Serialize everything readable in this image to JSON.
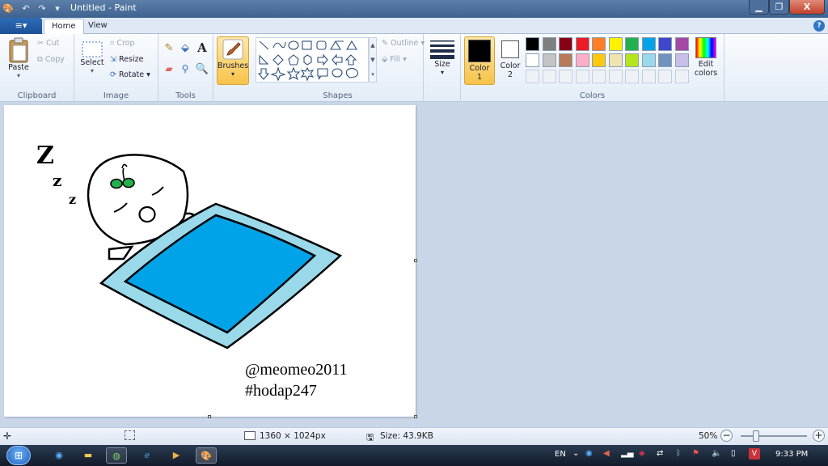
{
  "window": {
    "title": "Untitled - Paint",
    "min": "▁",
    "max": "❐",
    "close": "X"
  },
  "tabs": {
    "app_menu": "≡▾",
    "home": "Home",
    "view": "View",
    "help": "?"
  },
  "ribbon": {
    "clipboard": {
      "label": "Clipboard",
      "paste": "Paste",
      "cut": "Cut",
      "copy": "Copy"
    },
    "image": {
      "label": "Image",
      "select": "Select",
      "crop": "Crop",
      "resize": "Resize",
      "rotate": "Rotate"
    },
    "tools": {
      "label": "Tools"
    },
    "brushes": {
      "label": "Brushes"
    },
    "shapes": {
      "label": "Shapes",
      "outline": "Outline",
      "fill": "Fill"
    },
    "size": {
      "label": "Size"
    },
    "colors": {
      "label": "Colors",
      "color1": "Color\n1",
      "color1_a": "Color",
      "color1_b": "1",
      "color2_a": "Color",
      "color2_b": "2",
      "edit_a": "Edit",
      "edit_b": "colors",
      "row1": [
        "#000000",
        "#7f7f7f",
        "#880015",
        "#ed1c24",
        "#ff7f27",
        "#fff200",
        "#22b14c",
        "#00a2e8",
        "#3f48cc",
        "#a349a4"
      ],
      "row2": [
        "#ffffff",
        "#c3c3c3",
        "#b97a57",
        "#ffaec9",
        "#ffc90e",
        "#efe4b0",
        "#b5e61d",
        "#99d9ea",
        "#7092be",
        "#c8bfe7"
      ],
      "color1_value": "#000000",
      "color2_value": "#ffffff"
    }
  },
  "canvas": {
    "z_big": "Z",
    "z_mid": "z",
    "z_small": "z",
    "caption1": "@meomeo2011",
    "caption2": "#hodap247"
  },
  "status": {
    "dimensions": "1360 × 1024px",
    "size": "Size: 43.9KB",
    "zoom": "50%"
  },
  "taskbar": {
    "lang": "EN",
    "time": "9:33 PM"
  }
}
